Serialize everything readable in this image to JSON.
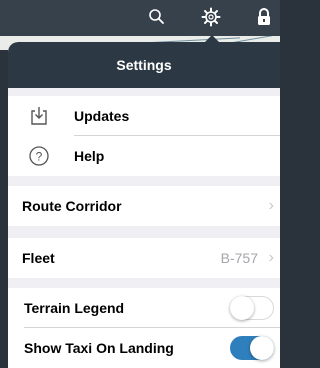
{
  "popover": {
    "title": "Settings"
  },
  "rows": {
    "updates": {
      "label": "Updates",
      "icon": "download-icon"
    },
    "help": {
      "label": "Help",
      "icon": "help-icon"
    },
    "route_corridor": {
      "label": "Route Corridor"
    },
    "fleet": {
      "label": "Fleet",
      "value": "B-757"
    },
    "terrain_legend": {
      "label": "Terrain Legend",
      "enabled": false
    },
    "show_taxi": {
      "label": "Show Taxi On Landing",
      "enabled": true
    }
  },
  "toolbar": {
    "icons": [
      "search-icon",
      "gear-icon",
      "lock-icon"
    ]
  },
  "colors": {
    "accent": "#2f7fbc",
    "header": "#2c3944",
    "toolbar": "#36414c",
    "group_bg": "#efeff4"
  }
}
